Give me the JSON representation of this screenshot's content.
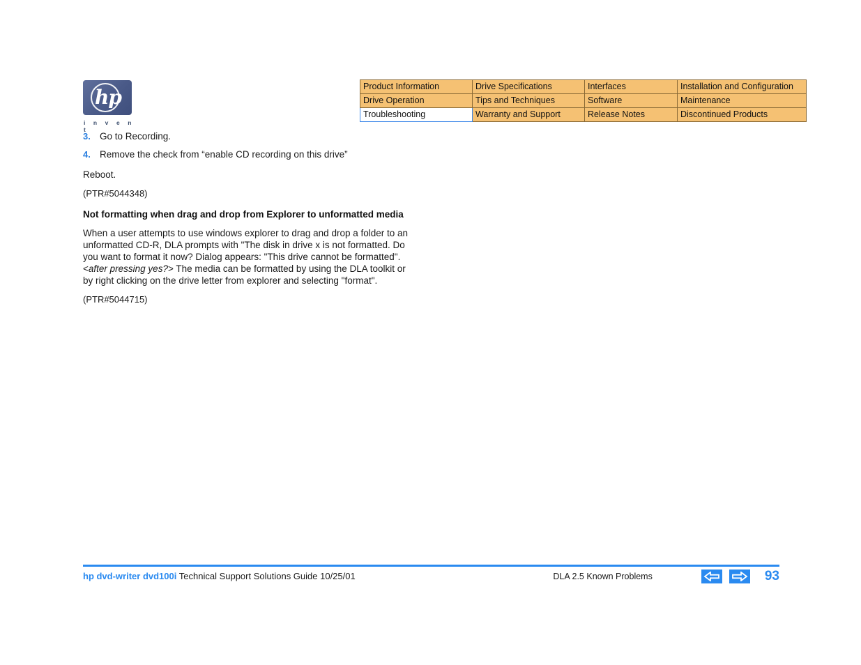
{
  "logo": {
    "wordmark": "hp",
    "tagline": "i n v e n t"
  },
  "nav_table": {
    "rows": [
      [
        {
          "label": "Product Information",
          "current": false
        },
        {
          "label": "Drive Specifications",
          "current": false
        },
        {
          "label": "Interfaces",
          "current": false
        },
        {
          "label": "Installation and Configuration",
          "current": false
        }
      ],
      [
        {
          "label": "Drive Operation",
          "current": false
        },
        {
          "label": "Tips and Techniques",
          "current": false
        },
        {
          "label": "Software",
          "current": false
        },
        {
          "label": "Maintenance",
          "current": false
        }
      ],
      [
        {
          "label": "Troubleshooting",
          "current": true
        },
        {
          "label": "Warranty and Support",
          "current": false
        },
        {
          "label": "Release Notes",
          "current": false
        },
        {
          "label": "Discontinued Products",
          "current": false
        }
      ]
    ],
    "highlight_color": "#f5c173",
    "current_border_color": "#3b86e8"
  },
  "content": {
    "steps": [
      {
        "number": "3.",
        "text": "Go to Recording."
      },
      {
        "number": "4.",
        "text": "Remove the check from “enable CD recording on this drive”"
      }
    ],
    "reboot_line": "Reboot.",
    "ptr_first": "(PTR#5044348)",
    "subheading": "Not formatting when drag and drop from Explorer to unformatted media",
    "paragraph_part1": "When a user attempts to use windows explorer to drag and drop a folder to an unformatted CD-R, DLA prompts with   \"The disk in drive x is not formatted. Do you want to format it now? Dialog appears: \"This drive cannot be formatted\". <",
    "paragraph_italic": "after pressing yes?",
    "paragraph_part2": "> The media can be formatted by using the DLA toolkit or by right clicking on the drive letter from explorer and selecting \"format\".",
    "ptr_second": "(PTR#5044715)"
  },
  "footer": {
    "brand": "hp dvd-writer  dvd100i",
    "guide": "Technical Support Solutions Guide 10/25/01",
    "section": "DLA 2.5 Known Problems",
    "page_number": "93",
    "accent_color": "#2a8af0"
  }
}
